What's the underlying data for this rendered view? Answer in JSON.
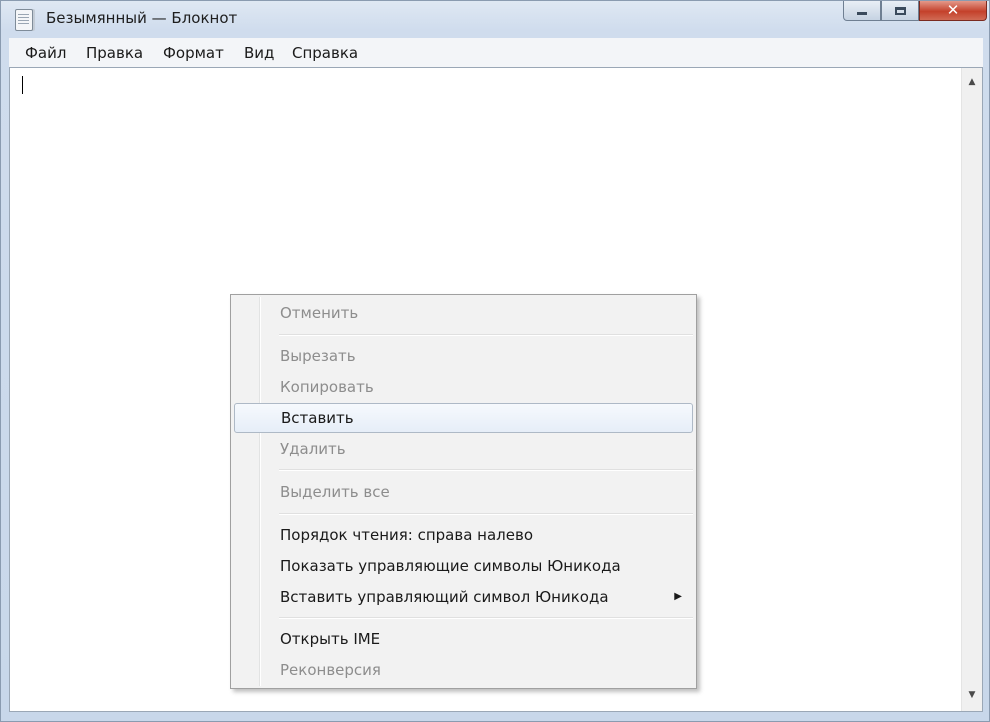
{
  "window": {
    "title": "Безымянный — Блокнот"
  },
  "title_controls": {
    "minimize_glyph": "",
    "close_glyph": "✕"
  },
  "menubar": {
    "items": [
      {
        "label": "Файл"
      },
      {
        "label": "Правка"
      },
      {
        "label": "Формат"
      },
      {
        "label": "Вид"
      },
      {
        "label": "Справка"
      }
    ]
  },
  "editor": {
    "content": ""
  },
  "scrollbar": {
    "up_glyph": "▲",
    "down_glyph": "▼"
  },
  "context_menu": {
    "items": [
      {
        "label": "Отменить",
        "enabled": false
      },
      {
        "label": "Вырезать",
        "enabled": false
      },
      {
        "label": "Копировать",
        "enabled": false
      },
      {
        "label": "Вставить",
        "enabled": true,
        "highlighted": true
      },
      {
        "label": "Удалить",
        "enabled": false
      },
      {
        "label": "Выделить все",
        "enabled": false
      },
      {
        "label": "Порядок чтения: справа налево",
        "enabled": true
      },
      {
        "label": "Показать управляющие символы Юникода",
        "enabled": true
      },
      {
        "label": "Вставить управляющий символ Юникода",
        "enabled": true,
        "submenu_arrow": "▶"
      },
      {
        "label": "Открыть IME",
        "enabled": true
      },
      {
        "label": "Реконверсия",
        "enabled": false
      }
    ]
  },
  "colors": {
    "disabled_text": "#8d8d8d",
    "close_button": "#c4412b"
  }
}
